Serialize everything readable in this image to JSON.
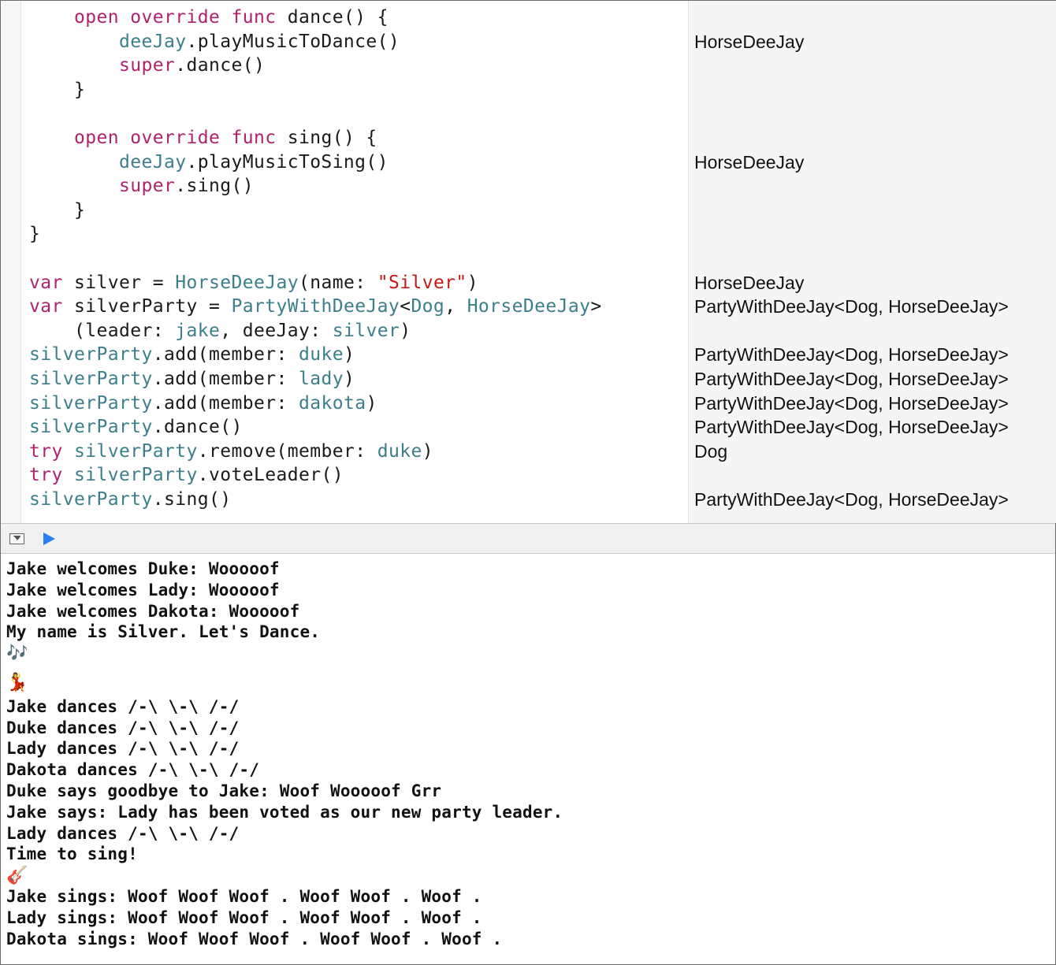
{
  "editor": {
    "code_lines": [
      {
        "indent": "    ",
        "tokens": [
          {
            "t": "open override func ",
            "c": "kw"
          },
          {
            "t": "dance() {",
            "c": "pl"
          }
        ]
      },
      {
        "indent": "        ",
        "tokens": [
          {
            "t": "deeJay",
            "c": "id"
          },
          {
            "t": ".playMusicToDance()",
            "c": "pl"
          }
        ]
      },
      {
        "indent": "        ",
        "tokens": [
          {
            "t": "super",
            "c": "kw"
          },
          {
            "t": ".dance()",
            "c": "pl"
          }
        ]
      },
      {
        "indent": "    ",
        "tokens": [
          {
            "t": "}",
            "c": "pl"
          }
        ]
      },
      {
        "indent": "",
        "tokens": []
      },
      {
        "indent": "    ",
        "tokens": [
          {
            "t": "open override func ",
            "c": "kw"
          },
          {
            "t": "sing() {",
            "c": "pl"
          }
        ]
      },
      {
        "indent": "        ",
        "tokens": [
          {
            "t": "deeJay",
            "c": "id"
          },
          {
            "t": ".playMusicToSing()",
            "c": "pl"
          }
        ]
      },
      {
        "indent": "        ",
        "tokens": [
          {
            "t": "super",
            "c": "kw"
          },
          {
            "t": ".sing()",
            "c": "pl"
          }
        ]
      },
      {
        "indent": "    ",
        "tokens": [
          {
            "t": "}",
            "c": "pl"
          }
        ]
      },
      {
        "indent": "",
        "tokens": [
          {
            "t": "}",
            "c": "pl"
          }
        ]
      },
      {
        "indent": "",
        "tokens": []
      },
      {
        "indent": "",
        "tokens": [
          {
            "t": "var ",
            "c": "kw"
          },
          {
            "t": "silver = ",
            "c": "pl"
          },
          {
            "t": "HorseDeeJay",
            "c": "id"
          },
          {
            "t": "(name: ",
            "c": "pl"
          },
          {
            "t": "\"Silver\"",
            "c": "str"
          },
          {
            "t": ")",
            "c": "pl"
          }
        ]
      },
      {
        "indent": "",
        "tokens": [
          {
            "t": "var ",
            "c": "kw"
          },
          {
            "t": "silverParty = ",
            "c": "pl"
          },
          {
            "t": "PartyWithDeeJay",
            "c": "id"
          },
          {
            "t": "<",
            "c": "pl"
          },
          {
            "t": "Dog",
            "c": "id"
          },
          {
            "t": ", ",
            "c": "pl"
          },
          {
            "t": "HorseDeeJay",
            "c": "id"
          },
          {
            "t": ">",
            "c": "pl"
          }
        ]
      },
      {
        "indent": "    ",
        "tokens": [
          {
            "t": "(leader: ",
            "c": "pl"
          },
          {
            "t": "jake",
            "c": "id"
          },
          {
            "t": ", deeJay: ",
            "c": "pl"
          },
          {
            "t": "silver",
            "c": "id"
          },
          {
            "t": ")",
            "c": "pl"
          }
        ]
      },
      {
        "indent": "",
        "tokens": [
          {
            "t": "silverParty",
            "c": "id"
          },
          {
            "t": ".add(member: ",
            "c": "pl"
          },
          {
            "t": "duke",
            "c": "id"
          },
          {
            "t": ")",
            "c": "pl"
          }
        ]
      },
      {
        "indent": "",
        "tokens": [
          {
            "t": "silverParty",
            "c": "id"
          },
          {
            "t": ".add(member: ",
            "c": "pl"
          },
          {
            "t": "lady",
            "c": "id"
          },
          {
            "t": ")",
            "c": "pl"
          }
        ]
      },
      {
        "indent": "",
        "tokens": [
          {
            "t": "silverParty",
            "c": "id"
          },
          {
            "t": ".add(member: ",
            "c": "pl"
          },
          {
            "t": "dakota",
            "c": "id"
          },
          {
            "t": ")",
            "c": "pl"
          }
        ]
      },
      {
        "indent": "",
        "tokens": [
          {
            "t": "silverParty",
            "c": "id"
          },
          {
            "t": ".dance()",
            "c": "pl"
          }
        ]
      },
      {
        "indent": "",
        "tokens": [
          {
            "t": "try ",
            "c": "kw"
          },
          {
            "t": "silverParty",
            "c": "id"
          },
          {
            "t": ".remove(member: ",
            "c": "pl"
          },
          {
            "t": "duke",
            "c": "id"
          },
          {
            "t": ")",
            "c": "pl"
          }
        ]
      },
      {
        "indent": "",
        "tokens": [
          {
            "t": "try ",
            "c": "kw"
          },
          {
            "t": "silverParty",
            "c": "id"
          },
          {
            "t": ".voteLeader()",
            "c": "pl"
          }
        ]
      },
      {
        "indent": "",
        "tokens": [
          {
            "t": "silverParty",
            "c": "id"
          },
          {
            "t": ".sing()",
            "c": "pl"
          }
        ]
      }
    ],
    "results": [
      {
        "line": 1,
        "text": "HorseDeeJay"
      },
      {
        "line": 6,
        "text": "HorseDeeJay"
      },
      {
        "line": 11,
        "text": "HorseDeeJay"
      },
      {
        "line": 12,
        "text": "PartyWithDeeJay<Dog, HorseDeeJay>"
      },
      {
        "line": 14,
        "text": "PartyWithDeeJay<Dog, HorseDeeJay>"
      },
      {
        "line": 15,
        "text": "PartyWithDeeJay<Dog, HorseDeeJay>"
      },
      {
        "line": 16,
        "text": "PartyWithDeeJay<Dog, HorseDeeJay>"
      },
      {
        "line": 17,
        "text": "PartyWithDeeJay<Dog, HorseDeeJay>"
      },
      {
        "line": 18,
        "text": "Dog"
      },
      {
        "line": 20,
        "text": "PartyWithDeeJay<Dog, HorseDeeJay>"
      }
    ]
  },
  "debug_bar": {
    "toggle_icon": "hide-debug-area-icon",
    "run_icon": "play-icon",
    "run_color": "#2a7ef0"
  },
  "console": {
    "lines": [
      {
        "text": "Jake welcomes Duke: Wooooof"
      },
      {
        "text": "Jake welcomes Lady: Wooooof"
      },
      {
        "text": "Jake welcomes Dakota: Wooooof"
      },
      {
        "text": "My name is Silver. Let's Dance."
      },
      {
        "text": "🎶",
        "emoji": true
      },
      {
        "text": "💃",
        "emoji": true
      },
      {
        "text": "Jake dances /-\\ \\-\\ /-/"
      },
      {
        "text": "Duke dances /-\\ \\-\\ /-/"
      },
      {
        "text": "Lady dances /-\\ \\-\\ /-/"
      },
      {
        "text": "Dakota dances /-\\ \\-\\ /-/"
      },
      {
        "text": "Duke says goodbye to Jake: Woof Wooooof Grr"
      },
      {
        "text": "Jake says: Lady has been voted as our new party leader."
      },
      {
        "text": "Lady dances /-\\ \\-\\ /-/"
      },
      {
        "text": "Time to sing!"
      },
      {
        "text": "🎸",
        "emoji": true
      },
      {
        "text": "Jake sings: Woof Woof Woof . Woof Woof . Woof ."
      },
      {
        "text": "Lady sings: Woof Woof Woof . Woof Woof . Woof ."
      },
      {
        "text": "Dakota sings: Woof Woof Woof . Woof Woof . Woof ."
      }
    ]
  }
}
